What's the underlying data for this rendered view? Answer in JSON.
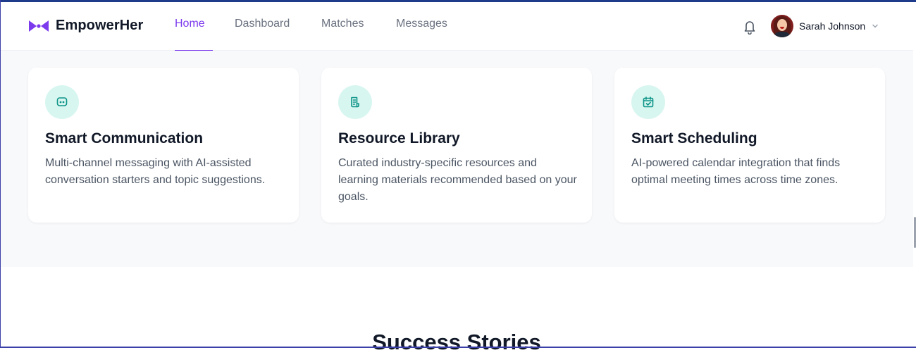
{
  "brand": {
    "name": "EmpowerHer",
    "accent": "#7c3aed"
  },
  "nav": {
    "items": [
      {
        "label": "Home",
        "active": true
      },
      {
        "label": "Dashboard",
        "active": false
      },
      {
        "label": "Matches",
        "active": false
      },
      {
        "label": "Messages",
        "active": false
      }
    ]
  },
  "header": {
    "notification_icon": "bell-icon",
    "user": {
      "name": "Sarah Johnson",
      "dropdown_icon": "chevron-down-icon"
    }
  },
  "features": {
    "cards": [
      {
        "icon": "chat-icon",
        "title": "Smart Communication",
        "description": "Multi-channel messaging with AI-assisted conversation starters and topic suggestions."
      },
      {
        "icon": "document-icon",
        "title": "Resource Library",
        "description": "Curated industry-specific resources and learning materials recommended based on your goals."
      },
      {
        "icon": "calendar-check-icon",
        "title": "Smart Scheduling",
        "description": "AI-powered calendar integration that finds optimal meeting times across time zones."
      }
    ],
    "icon_color": "#0d9488",
    "icon_bg": "#d8f6f0"
  },
  "stories": {
    "title": "Success Stories"
  }
}
